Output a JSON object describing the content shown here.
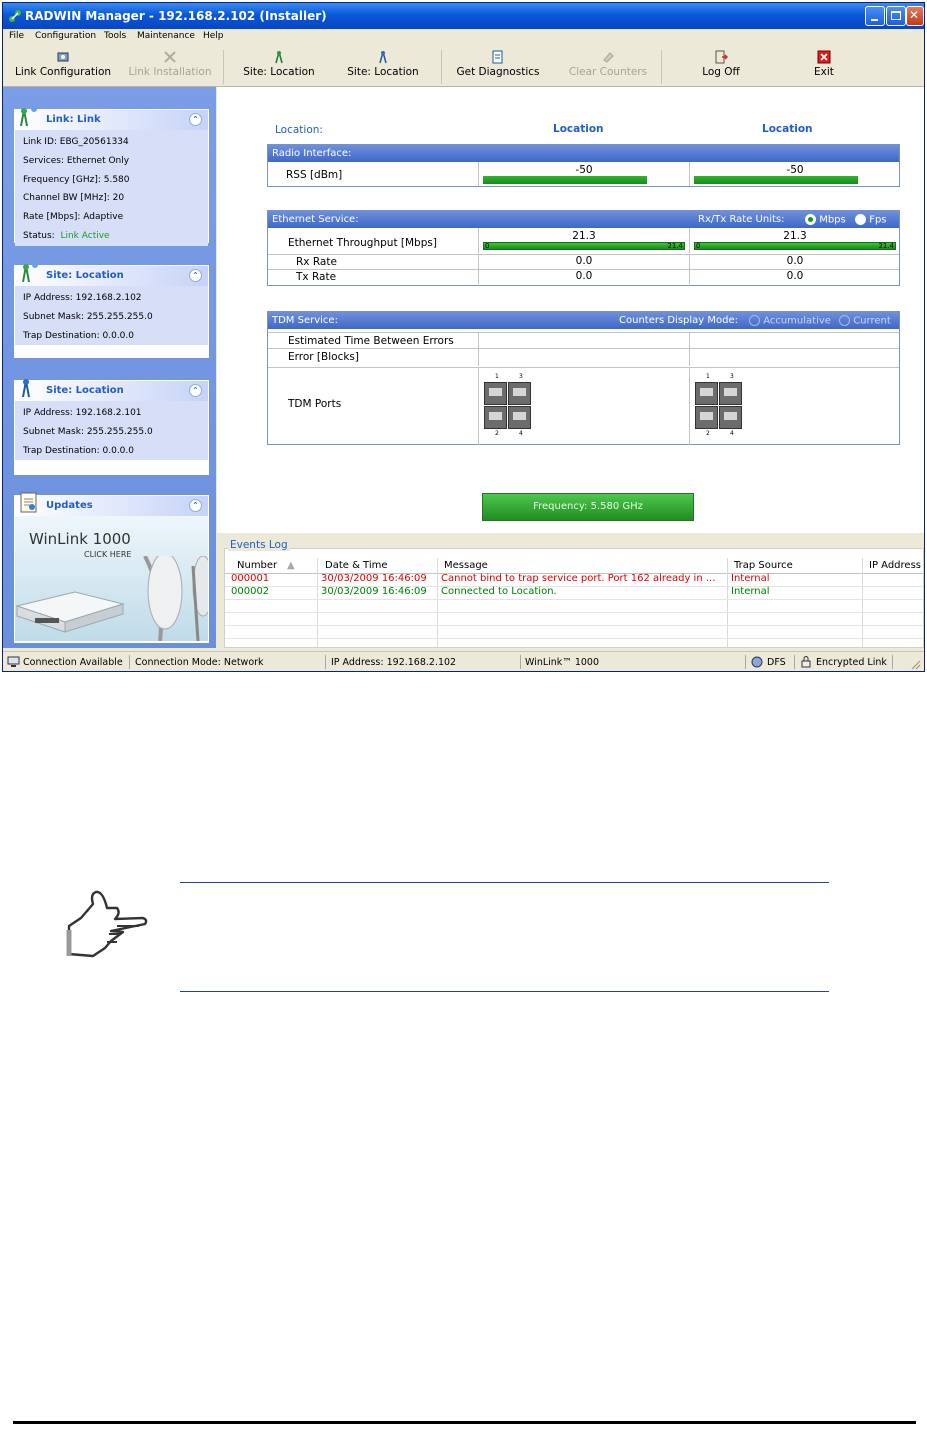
{
  "window": {
    "title": "RADWIN Manager - 192.168.2.102 (Installer)",
    "controls": [
      "minimize-icon",
      "maximize-icon",
      "close-icon"
    ]
  },
  "menu": [
    "File",
    "Configuration",
    "Tools",
    "Maintenance",
    "Help"
  ],
  "toolbar": [
    {
      "label": "Link Configuration",
      "icon": "link-config-icon",
      "enabled": true
    },
    {
      "label": "Link Installation",
      "icon": "link-install-icon",
      "enabled": false
    },
    {
      "label": "Site: Location",
      "icon": "site-antenna-icon",
      "enabled": true
    },
    {
      "label": "Site: Location",
      "icon": "site-antenna-icon",
      "enabled": true
    },
    {
      "label": "Get Diagnostics",
      "icon": "diagnostics-icon",
      "enabled": true
    },
    {
      "label": "Clear Counters",
      "icon": "eraser-icon",
      "enabled": false
    },
    {
      "label": "Log Off",
      "icon": "log-off-icon",
      "enabled": true
    },
    {
      "label": "Exit",
      "icon": "exit-icon",
      "enabled": true
    }
  ],
  "left_panels": {
    "link": {
      "title": "Link: Link",
      "rows": [
        "Link ID:   EBG_20561334",
        "Services:   Ethernet Only",
        "Frequency [GHz]:   5.580",
        "Channel BW [MHz]:   20",
        "Rate [Mbps]:   Adaptive"
      ],
      "status_label": "Status:",
      "status_value": "Link Active"
    },
    "site1": {
      "title": "Site: Location",
      "rows": [
        "IP Address:   192.168.2.102",
        "Subnet Mask:   255.255.255.0",
        "Trap Destination:   0.0.0.0"
      ]
    },
    "site2": {
      "title": "Site: Location",
      "rows": [
        "IP Address:   192.168.2.101",
        "Subnet Mask:   255.255.255.0",
        "Trap Destination:   0.0.0.0"
      ]
    },
    "updates": {
      "title": "Updates",
      "banner_title": "WinLink 1000",
      "banner_sub": "CLICK HERE"
    }
  },
  "main": {
    "location_label": "Location:",
    "site_a": "Location",
    "site_b": "Location",
    "radio": {
      "header": "Radio Interface:",
      "rss_label": "RSS [dBm]",
      "rss_a": "-50",
      "rss_b": "-50",
      "rss_fill_fraction": 0.77
    },
    "ethernet": {
      "header": "Ethernet Service:",
      "units_label": "Rx/Tx Rate Units:",
      "unit_mbps": "Mbps",
      "unit_fps": "Fps",
      "selected_unit": "Mbps",
      "throughput_label": "Ethernet Throughput [Mbps]",
      "throughput_a": "21.3",
      "throughput_b": "21.3",
      "bar_min": "0",
      "bar_max": "21.4",
      "rx_label": "Rx Rate",
      "rx_a": "0.0",
      "rx_b": "0.0",
      "tx_label": "Tx Rate",
      "tx_a": "0.0",
      "tx_b": "0.0"
    },
    "tdm": {
      "header": "TDM Service:",
      "mode_label": "Counters Display Mode:",
      "mode_accum": "Accumulative",
      "mode_current": "Current",
      "est_label": "Estimated Time Between Errors",
      "err_label": "Error [Blocks]",
      "ports_label": "TDM Ports",
      "port_numbers_top": [
        "1",
        "3"
      ],
      "port_numbers_bottom": [
        "2",
        "4"
      ]
    },
    "frequency_button": "Frequency: 5.580 GHz"
  },
  "events": {
    "title": "Events Log",
    "columns": [
      "Number",
      "Date & Time",
      "Message",
      "Trap Source",
      "IP Address"
    ],
    "rows": [
      {
        "number": "000001",
        "datetime": "30/03/2009 16:46:09",
        "message": "Cannot bind to trap service port. Port 162 already in ...",
        "source": "Internal",
        "ip": "",
        "color": "#e00000"
      },
      {
        "number": "000002",
        "datetime": "30/03/2009 16:46:09",
        "message": "Connected to Location.",
        "source": "Internal",
        "ip": "",
        "color": "#008000"
      }
    ]
  },
  "statusbar": {
    "connection": "Connection Available",
    "mode": "Connection Mode: Network",
    "ip": "IP Address: 192.168.2.102",
    "product": "WinLink™ 1000",
    "dfs": "DFS",
    "encrypted": "Encrypted Link"
  }
}
